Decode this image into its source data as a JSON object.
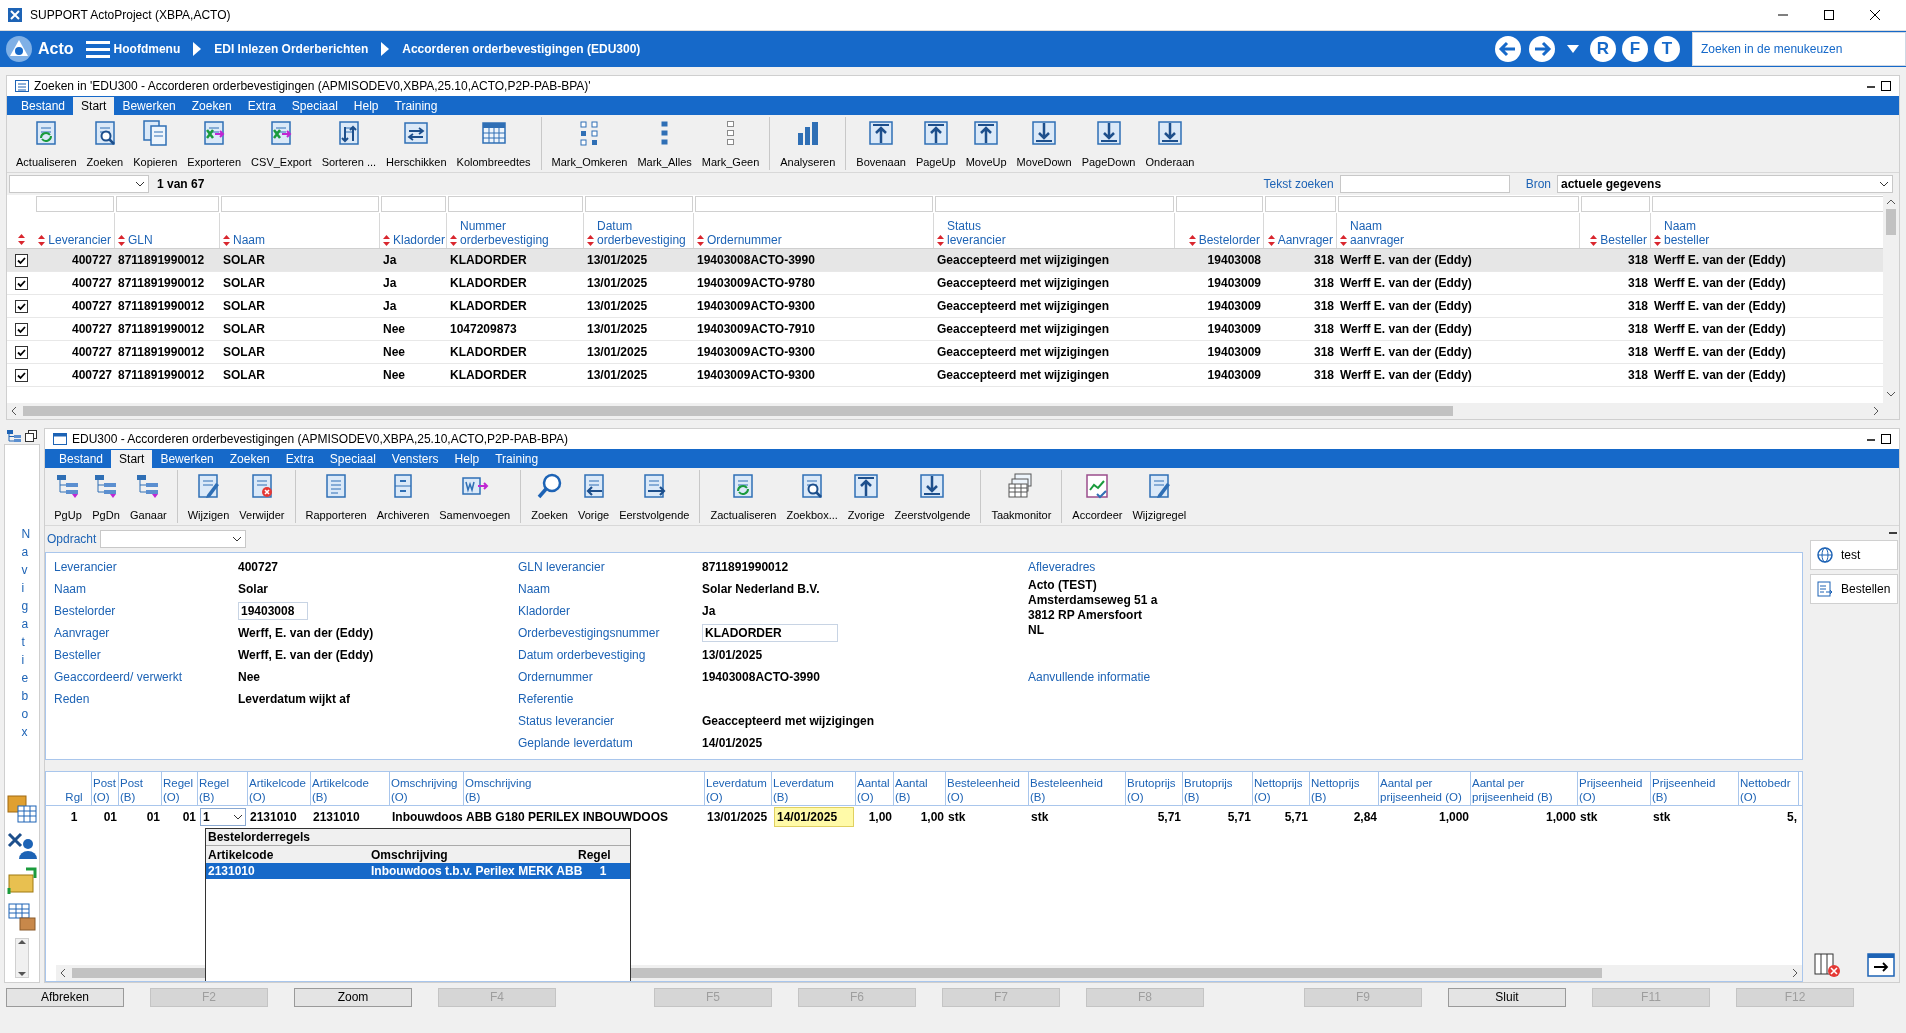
{
  "window": {
    "title": "SUPPORT ActoProject (XBPA,ACTO)"
  },
  "nav": {
    "app_name": "Acto",
    "breadcrumbs": [
      "Hoofdmenu",
      "EDI Inlezen Orderberichten",
      "Accorderen orderbevestigingen (EDU300)"
    ],
    "letter_buttons": [
      "R",
      "F",
      "T"
    ],
    "search_placeholder": "Zoeken in de menukeuzen"
  },
  "search_panel": {
    "title": "Zoeken in 'EDU300 - Accorderen orderbevestigingen (APMISODEV0,XBPA,25.10,ACTO,P2P-PAB-BPA)'",
    "menu": [
      {
        "label": "Bestand",
        "selected": false
      },
      {
        "label": "Start",
        "selected": true
      },
      {
        "label": "Bewerken",
        "selected": false
      },
      {
        "label": "Zoeken",
        "selected": false
      },
      {
        "label": "Extra",
        "selected": false
      },
      {
        "label": "Speciaal",
        "selected": false
      },
      {
        "label": "Help",
        "selected": false
      },
      {
        "label": "Training",
        "selected": false
      }
    ],
    "toolbar": [
      [
        {
          "label": "Actualiseren"
        },
        {
          "label": "Zoeken"
        },
        {
          "label": "Kopieren"
        },
        {
          "label": "Exporteren"
        },
        {
          "label": "CSV_Export"
        },
        {
          "label": "Sorteren ..."
        },
        {
          "label": "Herschikken"
        },
        {
          "label": "Kolombreedtes"
        }
      ],
      [
        {
          "label": "Mark_Omkeren"
        },
        {
          "label": "Mark_Alles"
        },
        {
          "label": "Mark_Geen"
        }
      ],
      [
        {
          "label": "Analyseren"
        }
      ],
      [
        {
          "label": "Bovenaan"
        },
        {
          "label": "PageUp"
        },
        {
          "label": "MoveUp"
        },
        {
          "label": "MoveDown"
        },
        {
          "label": "PageDown"
        },
        {
          "label": "Onderaan"
        }
      ]
    ],
    "record_counter": "1 van 67",
    "text_search_label": "Tekst zoeken",
    "source_label": "Bron",
    "source_value": "actuele gegevens",
    "table": {
      "columns": [
        {
          "line2": "Leverancier"
        },
        {
          "line2": "GLN"
        },
        {
          "line2": "Naam"
        },
        {
          "line2": "Kladorder"
        },
        {
          "line1": "Nummer",
          "line2": "orderbevestiging"
        },
        {
          "line1": "Datum",
          "line2": "orderbevestiging"
        },
        {
          "line2": "Ordernummer"
        },
        {
          "line1": "Status",
          "line2": "leverancier"
        },
        {
          "line2": "Bestelorder"
        },
        {
          "line2": "Aanvrager"
        },
        {
          "line1": "Naam",
          "line2": "aanvrager"
        },
        {
          "line2": "Besteller"
        },
        {
          "line1": "Naam",
          "line2": "besteller"
        }
      ],
      "rows": [
        {
          "checked": true,
          "selected": true,
          "cells": [
            "400727",
            "8711891990012",
            "SOLAR",
            "Ja",
            "KLADORDER",
            "13/01/2025",
            "19403008ACTO-3990",
            "Geaccepteerd met wijzigingen",
            "19403008",
            "318",
            "Werff E. van der (Eddy)",
            "318",
            "Werff E. van der (Eddy)"
          ]
        },
        {
          "checked": true,
          "selected": false,
          "cells": [
            "400727",
            "8711891990012",
            "SOLAR",
            "Ja",
            "KLADORDER",
            "13/01/2025",
            "19403009ACTO-9780",
            "Geaccepteerd met wijzigingen",
            "19403009",
            "318",
            "Werff E. van der (Eddy)",
            "318",
            "Werff E. van der (Eddy)"
          ]
        },
        {
          "checked": true,
          "selected": false,
          "cells": [
            "400727",
            "8711891990012",
            "SOLAR",
            "Ja",
            "KLADORDER",
            "13/01/2025",
            "19403009ACTO-9300",
            "Geaccepteerd met wijzigingen",
            "19403009",
            "318",
            "Werff E. van der (Eddy)",
            "318",
            "Werff E. van der (Eddy)"
          ]
        },
        {
          "checked": true,
          "selected": false,
          "cells": [
            "400727",
            "8711891990012",
            "SOLAR",
            "Nee",
            "1047209873",
            "13/01/2025",
            "19403009ACTO-7910",
            "Geaccepteerd met wijzigingen",
            "19403009",
            "318",
            "Werff E. van der (Eddy)",
            "318",
            "Werff E. van der (Eddy)"
          ]
        },
        {
          "checked": true,
          "selected": false,
          "cells": [
            "400727",
            "8711891990012",
            "SOLAR",
            "Nee",
            "KLADORDER",
            "13/01/2025",
            "19403009ACTO-9300",
            "Geaccepteerd met wijzigingen",
            "19403009",
            "318",
            "Werff E. van der (Eddy)",
            "318",
            "Werff E. van der (Eddy)"
          ]
        },
        {
          "checked": true,
          "selected": false,
          "cells": [
            "400727",
            "8711891990012",
            "SOLAR",
            "Nee",
            "KLADORDER",
            "13/01/2025",
            "19403009ACTO-9300",
            "Geaccepteerd met wijzigingen",
            "19403009",
            "318",
            "Werff E. van der (Eddy)",
            "318",
            "Werff E. van der (Eddy)"
          ]
        }
      ]
    }
  },
  "detail_panel": {
    "title": "EDU300 - Accorderen orderbevestigingen (APMISODEV0,XBPA,25.10,ACTO,P2P-PAB-BPA)",
    "navigation_label": "Navigatiebox",
    "menu": [
      {
        "label": "Bestand",
        "selected": false
      },
      {
        "label": "Start",
        "selected": true
      },
      {
        "label": "Bewerken",
        "selected": false
      },
      {
        "label": "Zoeken",
        "selected": false
      },
      {
        "label": "Extra",
        "selected": false
      },
      {
        "label": "Speciaal",
        "selected": false
      },
      {
        "label": "Vensters",
        "selected": false
      },
      {
        "label": "Help",
        "selected": false
      },
      {
        "label": "Training",
        "selected": false
      }
    ],
    "toolbar": [
      [
        {
          "label": "PgUp"
        },
        {
          "label": "PgDn"
        },
        {
          "label": "Ganaar"
        }
      ],
      [
        {
          "label": "Wijzigen"
        },
        {
          "label": "Verwijder"
        }
      ],
      [
        {
          "label": "Rapporteren"
        },
        {
          "label": "Archiveren"
        },
        {
          "label": "Samenvoegen"
        }
      ],
      [
        {
          "label": "Zoeken"
        },
        {
          "label": "Vorige"
        },
        {
          "label": "Eerstvolgende"
        }
      ],
      [
        {
          "label": "Zactualiseren"
        },
        {
          "label": "Zoekbox..."
        },
        {
          "label": "Zvorige"
        },
        {
          "label": "Zeerstvolgende"
        }
      ],
      [
        {
          "label": "Taakmonitor"
        }
      ],
      [
        {
          "label": "Accordeer"
        },
        {
          "label": "Wijzigregel"
        }
      ]
    ],
    "assignment_label": "Opdracht",
    "fields_left": [
      {
        "label": "Leverancier",
        "value": "400727",
        "kind": "text"
      },
      {
        "label": "Naam",
        "value": "Solar",
        "kind": "text"
      },
      {
        "label": "Bestelorder",
        "value": "19403008",
        "kind": "input"
      },
      {
        "label": "Aanvrager",
        "value": "Werff, E. van der (Eddy)",
        "kind": "text"
      },
      {
        "label": "Besteller",
        "value": "Werff, E. van der (Eddy)",
        "kind": "text"
      },
      {
        "label": "Geaccordeerd/ verwerkt",
        "value": "Nee",
        "kind": "text"
      },
      {
        "label": "Reden",
        "value": "Leverdatum wijkt af",
        "kind": "text"
      }
    ],
    "fields_middle": [
      {
        "label": "GLN leverancier",
        "value": "8711891990012",
        "kind": "text"
      },
      {
        "label": "Naam",
        "value": "Solar Nederland B.V.",
        "kind": "text"
      },
      {
        "label": "Kladorder",
        "value": "Ja",
        "kind": "text"
      },
      {
        "label": "Orderbevestigingsnummer",
        "value": "KLADORDER",
        "kind": "input"
      },
      {
        "label": "Datum orderbevestiging",
        "value": "13/01/2025",
        "kind": "text"
      },
      {
        "label": "Ordernummer",
        "value": "19403008ACTO-3990",
        "kind": "text"
      },
      {
        "label": "Referentie",
        "kind": "text"
      },
      {
        "label": "Status leverancier",
        "value": "Geaccepteerd met wijzigingen",
        "kind": "text"
      },
      {
        "label": "Geplande leverdatum",
        "value": "14/01/2025",
        "kind": "text"
      }
    ],
    "delivery_address_label": "Afleveradres",
    "delivery_address": [
      "Acto (TEST)",
      "Amsterdamseweg 51 a",
      "3812 RP Amersfoort",
      "NL"
    ],
    "extra_info_label": "Aanvullende informatie",
    "side_buttons": [
      "test",
      "Bestellen"
    ],
    "lines": {
      "columns": [
        {
          "line2": "Rgl"
        },
        {
          "line1": "Post",
          "line2": "(O)"
        },
        {
          "line1": "Post",
          "line2": "(B)"
        },
        {
          "line1": "Regel",
          "line2": "(O)"
        },
        {
          "line1": "Regel",
          "line2": "(B)"
        },
        {
          "line1": "Artikelcode",
          "line2": "(O)"
        },
        {
          "line1": "Artikelcode",
          "line2": "(B)"
        },
        {
          "line1": "Omschrijving",
          "line2": "(O)"
        },
        {
          "line1": "Omschrijving",
          "line2": "(B)"
        },
        {
          "line1": "Leverdatum",
          "line2": "(O)"
        },
        {
          "line1": "Leverdatum",
          "line2": "(B)"
        },
        {
          "line1": "Aantal",
          "line2": "(O)"
        },
        {
          "line1": "Aantal",
          "line2": "(B)"
        },
        {
          "line1": "Besteleenheid",
          "line2": "(O)"
        },
        {
          "line1": "Besteleenheid",
          "line2": "(B)"
        },
        {
          "line1": "Brutoprijs",
          "line2": "(O)"
        },
        {
          "line1": "Brutoprijs",
          "line2": "(B)"
        },
        {
          "line1": "Nettoprijs",
          "line2": "(O)"
        },
        {
          "line1": "Nettoprijs",
          "line2": "(B)"
        },
        {
          "line1": "Aantal per",
          "line2": "prijseenheid (O)"
        },
        {
          "line1": "Aantal per",
          "line2": "prijseenheid (B)"
        },
        {
          "line1": "Prijseenheid",
          "line2": "(O)"
        },
        {
          "line1": "Prijseenheid",
          "line2": "(B)"
        },
        {
          "line1": "Nettobedr",
          "line2": "(O)"
        }
      ],
      "rows": [
        {
          "cells": [
            "1",
            "01",
            "01",
            "01",
            "1",
            "2131010",
            "2131010",
            "Inbouwdoos",
            "ABB G180 PERILEX INBOUWDOOS",
            "13/01/2025",
            "14/01/2025",
            "1,00",
            "1,00",
            "stk",
            "stk",
            "5,71",
            "5,71",
            "5,71",
            "2,84",
            "1,000",
            "1,000",
            "stk",
            "stk",
            "5,"
          ]
        }
      ],
      "popup": {
        "title": "Bestelorderregels",
        "columns": [
          "Artikelcode",
          "Omschrijving",
          "Regel"
        ],
        "rows": [
          {
            "selected": true,
            "cells": [
              "2131010",
              "Inbouwdoos t.b.v. Perilex MERK ABB",
              "1"
            ]
          }
        ]
      }
    }
  },
  "function_keys": [
    {
      "label": "Afbreken",
      "disabled": false
    },
    {
      "label": "F2",
      "disabled": true
    },
    {
      "label": "Zoom",
      "disabled": false
    },
    {
      "label": "F4",
      "disabled": true
    },
    {
      "label": "F5",
      "disabled": true
    },
    {
      "label": "F6",
      "disabled": true
    },
    {
      "label": "F7",
      "disabled": true
    },
    {
      "label": "F8",
      "disabled": true
    },
    {
      "label": "F9",
      "disabled": true
    },
    {
      "label": "Sluit",
      "disabled": false
    },
    {
      "label": "F11",
      "disabled": true
    },
    {
      "label": "F12",
      "disabled": true
    }
  ]
}
